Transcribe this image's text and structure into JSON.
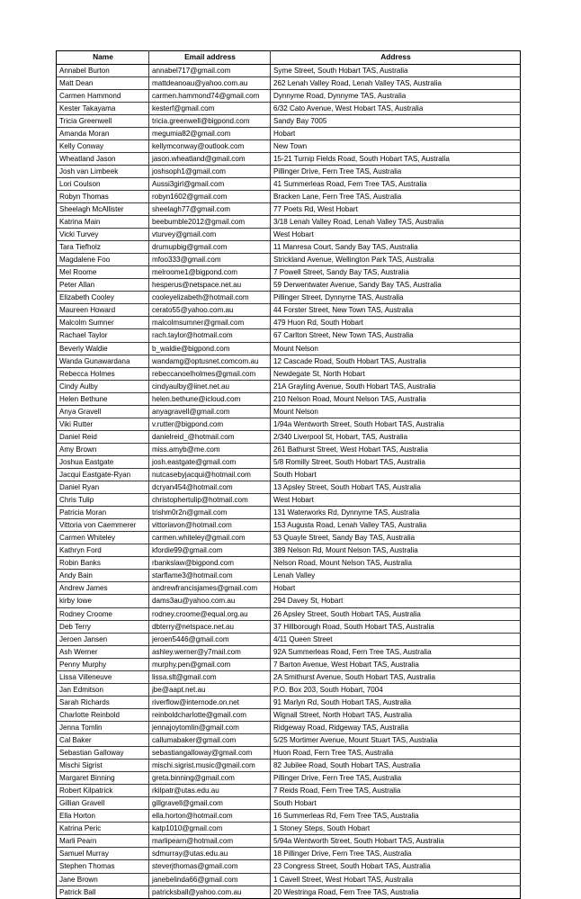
{
  "table": {
    "columns": [
      "Name",
      "Email address",
      "Address"
    ],
    "rows": [
      [
        "Annabel  Burton",
        "annabel717@gmail.com",
        "Syme Street, South Hobart TAS, Australia"
      ],
      [
        "Matt Dean",
        "mattdeanoau@yahoo.com.au",
        "262 Lenah Valley Road, Lenah Valley TAS, Australia"
      ],
      [
        "Carmen Hammond",
        "carmen.hammond74@gmail.com",
        "Dynnyme Road, Dynnyme TAS, Australia"
      ],
      [
        "Kester Takayama",
        "kesterf@gmail.com",
        "6/32 Cato Avenue, West Hobart TAS, Australia"
      ],
      [
        "Tricia  Greenwell",
        "tricia.greenwell@bigpond.com",
        "Sandy Bay 7005"
      ],
      [
        "Amanda Moran",
        "megumia82@gmail.com",
        "Hobart"
      ],
      [
        "Kelly  Conway",
        "kellymconway@outlook.com",
        "New Town"
      ],
      [
        "Wheatland  Jason",
        "jason.wheatland@gmail.com",
        "15-21 Turnip Fields Road, South Hobart TAS, Australia"
      ],
      [
        "Josh van Limbeek",
        "joshsoph1@gmail.com",
        "Pillinger Drive, Fern Tree TAS, Australia"
      ],
      [
        "Lori Coulson",
        "Aussi3girl@gmail.com",
        "41 Summerleas Road, Fern Tree TAS, Australia"
      ],
      [
        "Robyn Thomas",
        "robyn1602@gmail.com",
        "Bracken Lane, Fern Tree TAS, Australia"
      ],
      [
        "Sheelagh McAllister",
        "sheelagh77@gmail.com",
        "77 Poets Rd, West Hobart"
      ],
      [
        "Katrina Main",
        "beebumble2012@gmail.com",
        "3/18 Lenah Valley Road, Lenah Valley TAS, Australia"
      ],
      [
        "Vicki  Turvey",
        "vturvey@gmail.com",
        "West Hobart"
      ],
      [
        "Tara Tiefholz",
        "drumupbig@gmail.com",
        "11 Manresa Court, Sandy Bay TAS, Australia"
      ],
      [
        "Magdalene  Foo",
        "mfoo333@gmail.com",
        "Strickland Avenue, Wellington Park TAS, Australia"
      ],
      [
        "Mel Roome",
        "melroome1@bigpond.com",
        "7 Powell Street, Sandy Bay TAS, Australia"
      ],
      [
        "Peter  Allan",
        "hesperus@netspace.net.au",
        "59 Derwentwater Avenue, Sandy Bay TAS, Australia"
      ],
      [
        "Elizabeth  Cooley",
        "cooleyelizabeth@hotmail.com",
        "Pillinger Street, Dynnyrne TAS, Australia"
      ],
      [
        "Maureen Howard",
        "cerato55@yahoo.com.au",
        "44 Forster Street, New Town TAS, Australia"
      ],
      [
        "Malcolm Sumner",
        "malcolmsumner@gmail.com",
        "479 Huon Rd, South Hobart"
      ],
      [
        "Rachael  Taylor",
        "rach.taylor@hotmail.com",
        "67 Carlton Street, New Town TAS, Australia"
      ],
      [
        "Beverly Waldie",
        "b_waldie@bigpond.com",
        "Mount Nelson"
      ],
      [
        "Wanda Gunawardana",
        "wandamg@optusnet.comcom.au",
        "12 Cascade Road, South Hobart TAS, Australia"
      ],
      [
        "Rebecca Holmes",
        "rebeccanoelholmes@gmail.com",
        "Newdegate St, North Hobart"
      ],
      [
        "Cindy Aulby",
        "cindyaulby@iinet.net.au",
        "21A Grayling Avenue, South Hobart TAS, Australia"
      ],
      [
        "Helen Bethune",
        "helen.bethune@icloud.com",
        "210 Nelson Road, Mount Nelson TAS, Australia"
      ],
      [
        "Anya  Gravell",
        "anyagravell@gmail.com",
        "Mount Nelson"
      ],
      [
        "Viki Rutter",
        "v.rutter@bigpond.com",
        "1/94a Wentworth Street, South Hobart TAS, Australia"
      ],
      [
        "Daniel  Reid",
        "danielreid_@hotmail.com",
        "2/340 Liverpool St, Hobart, TAS, Australia"
      ],
      [
        "Amy Brown",
        "miss.amyb@me.com",
        "261 Bathurst Street, West Hobart TAS, Australia"
      ],
      [
        "Joshua Eastgate",
        "josh.eastgate@gmail.com",
        "5/8 Romilly Street, South Hobart TAS, Australia"
      ],
      [
        "Jacqui Eastgate-Ryan",
        "nutcasebyjacqui@hotmail.com",
        "South Hobart"
      ],
      [
        "Daniel Ryan",
        "dcryan454@hotmail.com",
        "13 Apsley Street, South Hobart TAS, Australia"
      ],
      [
        "Chris Tulip",
        "christophertulip@hotmail.com",
        "West Hobart"
      ],
      [
        "Patricia Moran",
        "trishm0r2n@gmail.com",
        "131 Waterworks Rd, Dynnyrne TAS, Australia"
      ],
      [
        "Vittoria  von Caemmerer",
        "vittoriavon@hotmail.com",
        "153 Augusta Road, Lenah Valley TAS, Australia"
      ],
      [
        "Carmen  Whiteley",
        "carmen.whiteley@gmail.com",
        "53 Quayle Street, Sandy Bay TAS, Australia"
      ],
      [
        "Kathryn  Ford",
        "kfordie99@gmail.com",
        "389 Nelson Rd, Mount Nelson TAS, Australia"
      ],
      [
        "Robin Banks",
        "rbankslaw@bigpond.com",
        "Nelson Road, Mount Nelson TAS, Australia"
      ],
      [
        "Andy Bain",
        "starflame3@hotmail.com",
        "Lenah Valley"
      ],
      [
        "Andrew James",
        "andrewfrancisjames@gmail.com",
        "Hobart"
      ],
      [
        "kirby lowe",
        "dams3au@yahoo.com.au",
        "294 Davey St, Hobart"
      ],
      [
        "Rodney Croome",
        "rodney.croome@equal.org.au",
        "26 Apsley Street, South Hobart TAS, Australia"
      ],
      [
        "Deb Terry",
        "dbterry@netspace.net.au",
        "37 Hillborough Road, South Hobart TAS, Australia"
      ],
      [
        "Jeroen Jansen",
        "jeroen5446@gmail.com",
        "4/11 Queen Street"
      ],
      [
        "Ash Werner",
        "ashley.werner@y7mail.com",
        "92A Summerleas Road, Fern Tree TAS, Australia"
      ],
      [
        "Penny Murphy",
        "murphy.pen@gmail.com",
        "7 Barton Avenue, West Hobart TAS, Australia"
      ],
      [
        "Lissa Villeneuve",
        "lissa.slt@gmail.com",
        "2A Smithurst Avenue, South Hobart TAS, Australia"
      ],
      [
        "Jan Edmitson",
        "jbe@aapt.net.au",
        "P.O. Box 203, South Hobart, 7004"
      ],
      [
        "Sarah Richards",
        "riverflow@internode.on.net",
        "91 Marlyn Rd, South Hobart TAS, Australia"
      ],
      [
        "Charlotte  Reinbold",
        "reinboldcharlotte@gmail.com",
        "Wignall Street, North Hobart TAS, Australia"
      ],
      [
        "Jenna Tomlin",
        "jennajoytomlin@gmail.com",
        "Ridgeway Road, Ridgeway TAS, Australia"
      ],
      [
        "Cal Baker",
        "callumabaker@gmail.com",
        "5/25 Mortimer Avenue, Mount Stuart TAS, Australia"
      ],
      [
        "Sebastian Galloway",
        "sebastiangalloway@gmail.com",
        "Huon Road, Fern Tree TAS, Australia"
      ],
      [
        "Mischi  Sigrist",
        "mischi.sigrist.music@gmail.com",
        "82 Jubilee Road, South Hobart TAS, Australia"
      ],
      [
        "Margaret  Binning",
        "greta.binning@gmail.com",
        "Pillinger Drive, Fern Tree TAS, Australia"
      ],
      [
        "Robert Kilpatrick",
        "rkilpatr@utas.edu.au",
        "7 Reids Road, Fern Tree TAS, Australia"
      ],
      [
        "Gillian Gravell",
        "gillgravell@gmail.com",
        "South Hobart"
      ],
      [
        "Ella Horton",
        "ella.horton@hotmail.com",
        "16 Summerleas Rd, Fern Tree TAS, Australia"
      ],
      [
        "Katrina  Peric",
        "katp1010@gmail.com",
        "1 Stoney Steps, South Hobart"
      ],
      [
        "Marli Pearn",
        "marlipearn@hotmail.com",
        "5/94a Wentworth Street, South Hobart TAS, Australia"
      ],
      [
        "Samuel Murray",
        "sdmurray@utas.edu.au",
        "18 Pillinger Drive, Fern Tree TAS, Australia"
      ],
      [
        "Stephen Thomas",
        "steverjthomas@gmail.com",
        "23 Congress Street, South Hobart TAS, Australia"
      ],
      [
        "Jane Brown",
        "janebelinda66@gmail.com",
        "1 Cavell Street, West Hobart TAS, Australia"
      ],
      [
        "Patrick Ball",
        "patricksball@yahoo.com.au",
        "20 Westringa Road, Fern Tree TAS, Australia"
      ]
    ]
  }
}
